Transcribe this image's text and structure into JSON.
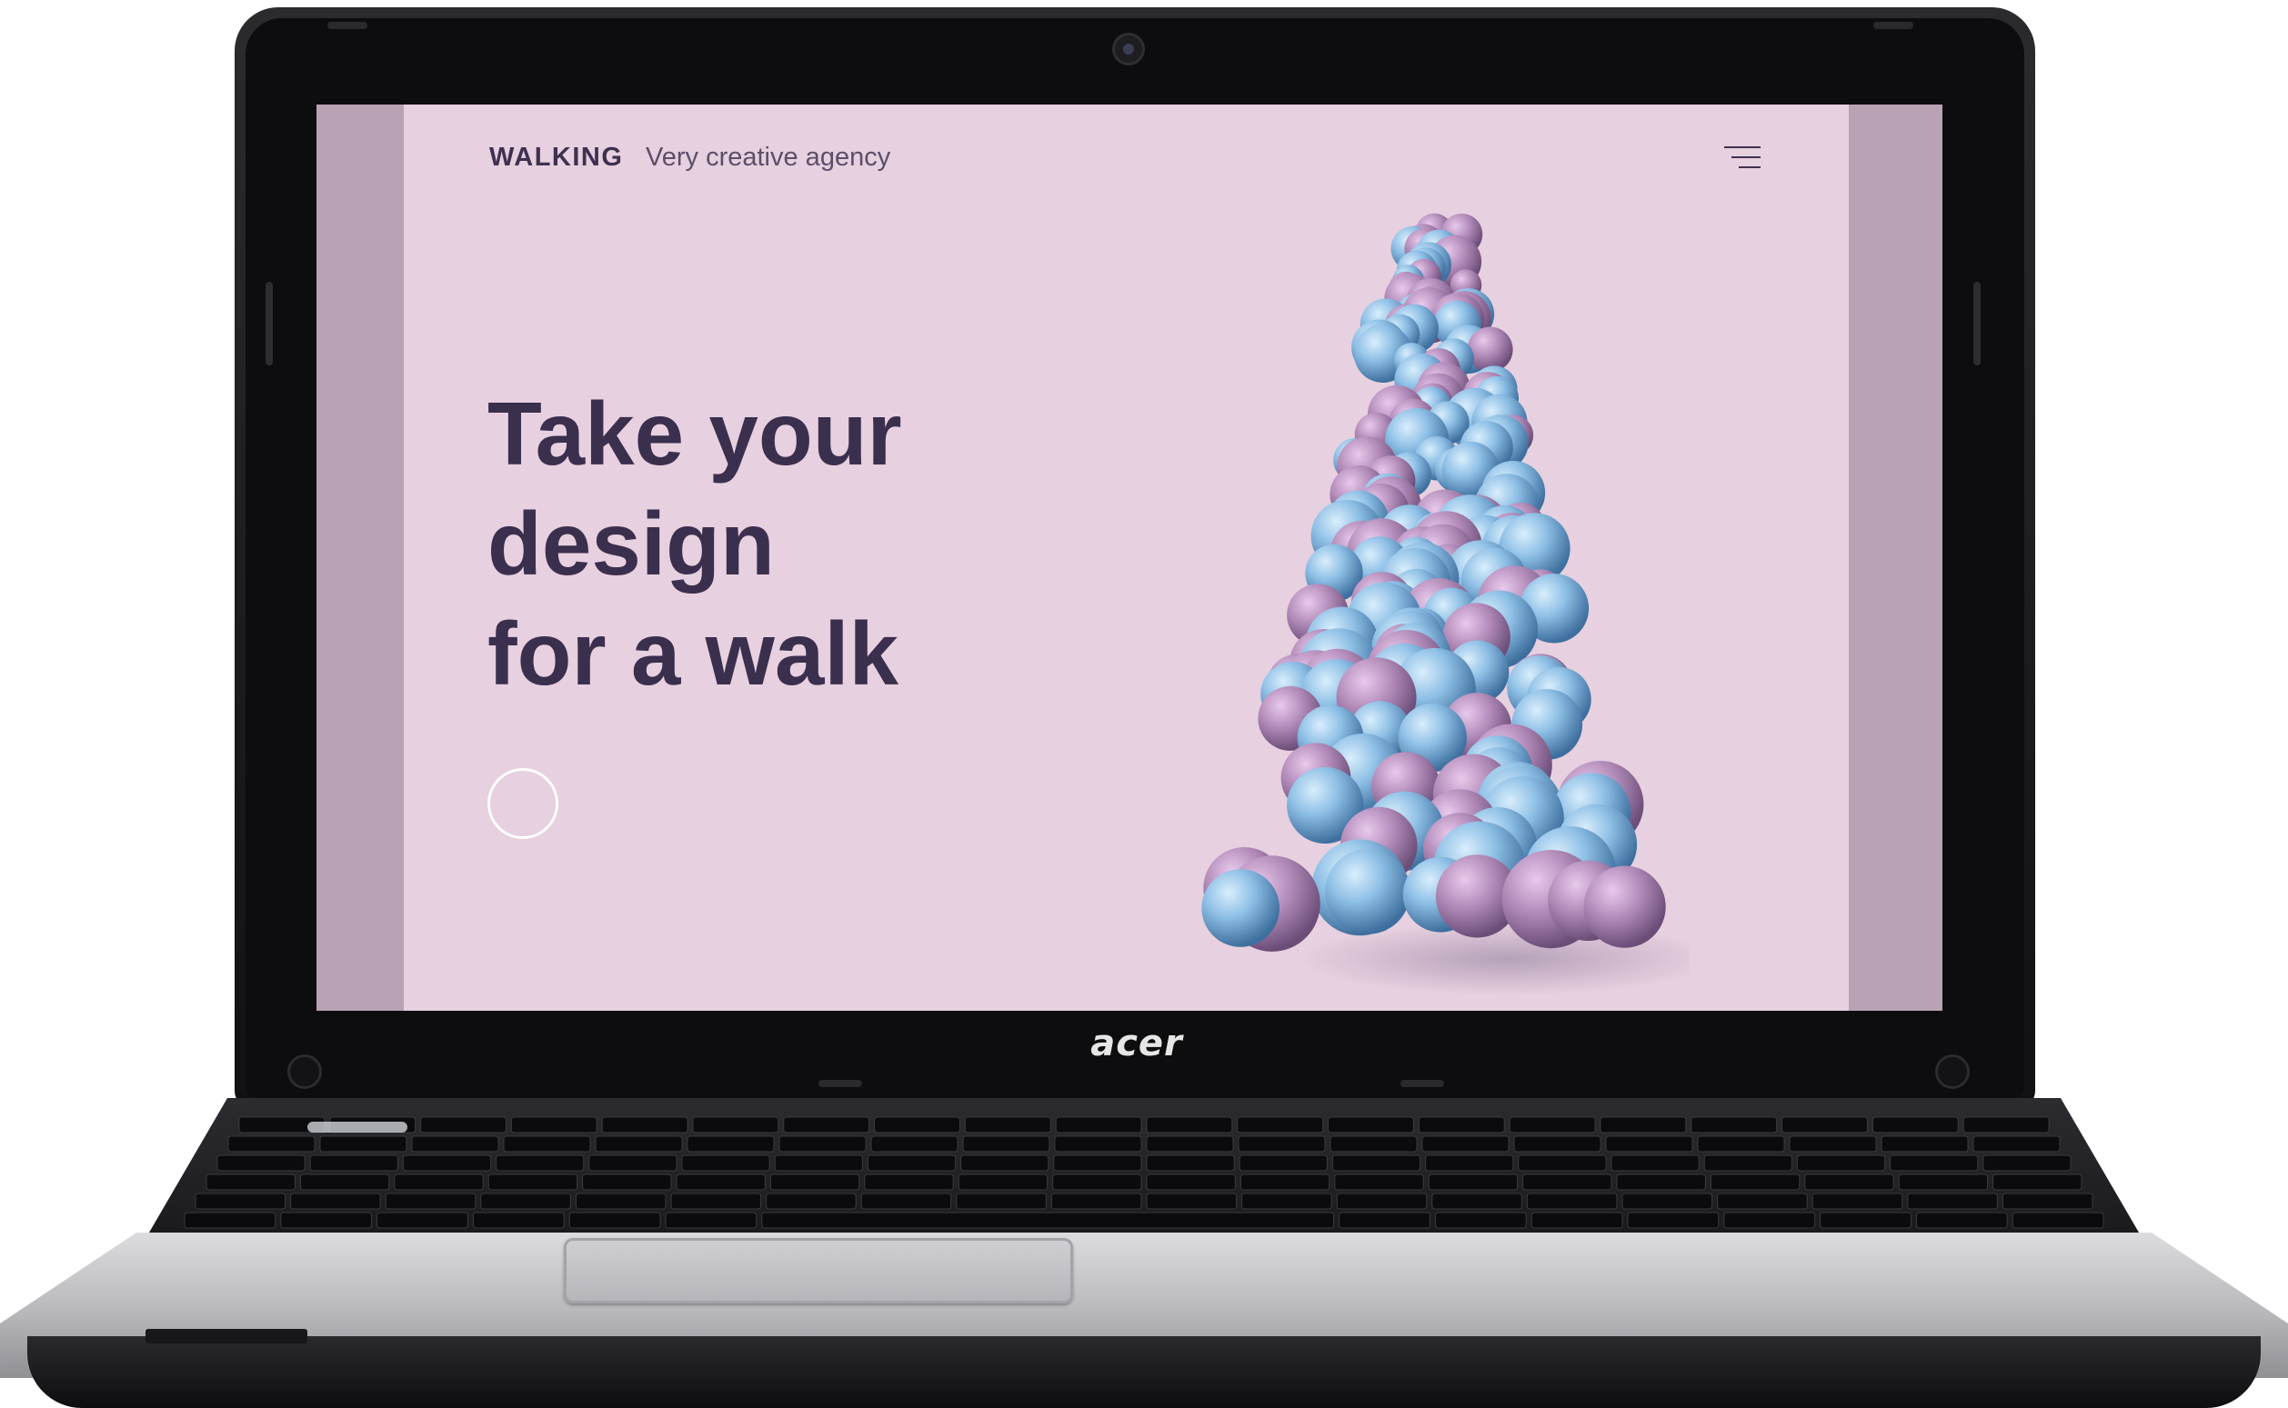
{
  "device": {
    "brand_logo": "acer"
  },
  "website": {
    "brand": "WALKING",
    "tagline": "Very creative agency",
    "headline_lines": [
      "Take your",
      "design",
      "for a walk"
    ],
    "colors": {
      "background": "#e7d0df",
      "side_strips": "#b9a2b3",
      "heading": "#3b2f4e",
      "sphere_blue": "#7fb3dc",
      "sphere_purple": "#b28ab7"
    },
    "icons": {
      "menu": "hamburger-menu-icon",
      "scroll": "circle-icon"
    }
  }
}
